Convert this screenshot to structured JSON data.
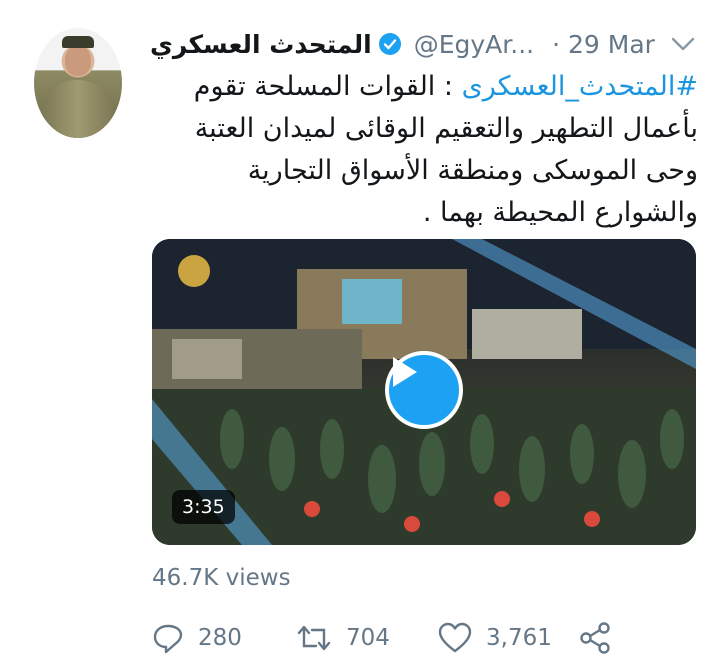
{
  "tweet": {
    "display_name": "المتحدث العسكري",
    "handle": "@EgyAr...",
    "date": "· 29 Mar",
    "hashtag": "#المتحدث_العسكرى",
    "body": " : القوات المسلحة تقوم بأعمال التطهير والتعقيم الوقائى لميدان العتبة وحى الموسكى ومنطقة الأسواق التجارية والشوارع المحيطة بهما ."
  },
  "media": {
    "duration": "3:35"
  },
  "stats": {
    "views": "46.7K views",
    "replies": "280",
    "retweets": "704",
    "likes": "3,761"
  },
  "icons": {
    "verified": "verified-badge-icon",
    "menu": "chevron-down-icon",
    "reply": "reply-icon",
    "retweet": "retweet-icon",
    "like": "heart-icon",
    "share": "share-icon"
  },
  "colors": {
    "accent": "#1da1f2",
    "hashtag": "#1b95e0",
    "secondary_text": "#657786"
  }
}
